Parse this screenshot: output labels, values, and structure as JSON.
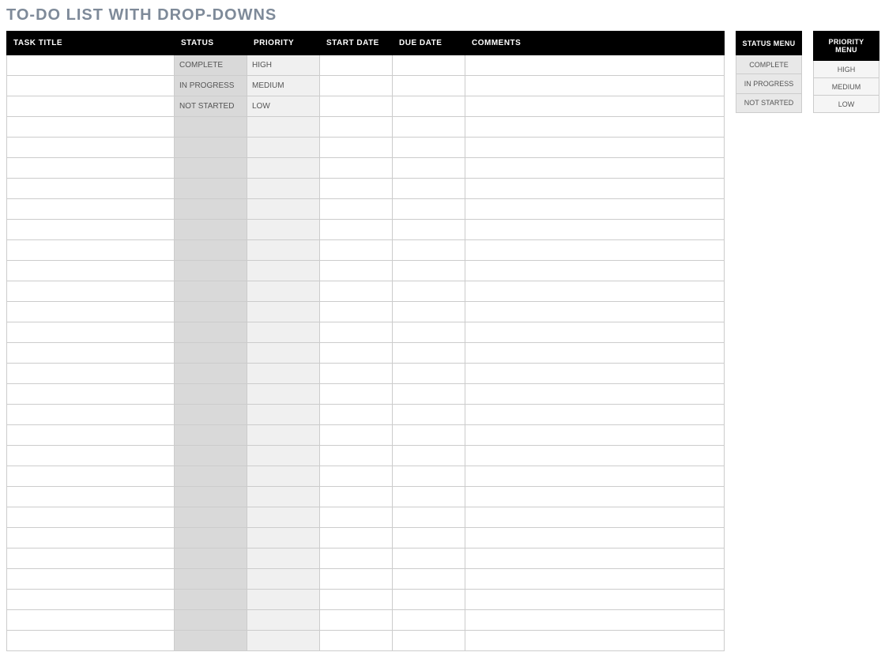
{
  "title": "TO-DO LIST WITH DROP-DOWNS",
  "columns": {
    "task": "TASK TITLE",
    "status": "STATUS",
    "priority": "PRIORITY",
    "start": "START DATE",
    "due": "DUE DATE",
    "comments": "COMMENTS"
  },
  "rows": [
    {
      "task": "",
      "status": "COMPLETE",
      "priority": "HIGH",
      "start": "",
      "due": "",
      "comments": ""
    },
    {
      "task": "",
      "status": "IN PROGRESS",
      "priority": "MEDIUM",
      "start": "",
      "due": "",
      "comments": ""
    },
    {
      "task": "",
      "status": "NOT STARTED",
      "priority": "LOW",
      "start": "",
      "due": "",
      "comments": ""
    },
    {
      "task": "",
      "status": "",
      "priority": "",
      "start": "",
      "due": "",
      "comments": ""
    },
    {
      "task": "",
      "status": "",
      "priority": "",
      "start": "",
      "due": "",
      "comments": ""
    },
    {
      "task": "",
      "status": "",
      "priority": "",
      "start": "",
      "due": "",
      "comments": ""
    },
    {
      "task": "",
      "status": "",
      "priority": "",
      "start": "",
      "due": "",
      "comments": ""
    },
    {
      "task": "",
      "status": "",
      "priority": "",
      "start": "",
      "due": "",
      "comments": ""
    },
    {
      "task": "",
      "status": "",
      "priority": "",
      "start": "",
      "due": "",
      "comments": ""
    },
    {
      "task": "",
      "status": "",
      "priority": "",
      "start": "",
      "due": "",
      "comments": ""
    },
    {
      "task": "",
      "status": "",
      "priority": "",
      "start": "",
      "due": "",
      "comments": ""
    },
    {
      "task": "",
      "status": "",
      "priority": "",
      "start": "",
      "due": "",
      "comments": ""
    },
    {
      "task": "",
      "status": "",
      "priority": "",
      "start": "",
      "due": "",
      "comments": ""
    },
    {
      "task": "",
      "status": "",
      "priority": "",
      "start": "",
      "due": "",
      "comments": ""
    },
    {
      "task": "",
      "status": "",
      "priority": "",
      "start": "",
      "due": "",
      "comments": ""
    },
    {
      "task": "",
      "status": "",
      "priority": "",
      "start": "",
      "due": "",
      "comments": ""
    },
    {
      "task": "",
      "status": "",
      "priority": "",
      "start": "",
      "due": "",
      "comments": ""
    },
    {
      "task": "",
      "status": "",
      "priority": "",
      "start": "",
      "due": "",
      "comments": ""
    },
    {
      "task": "",
      "status": "",
      "priority": "",
      "start": "",
      "due": "",
      "comments": ""
    },
    {
      "task": "",
      "status": "",
      "priority": "",
      "start": "",
      "due": "",
      "comments": ""
    },
    {
      "task": "",
      "status": "",
      "priority": "",
      "start": "",
      "due": "",
      "comments": ""
    },
    {
      "task": "",
      "status": "",
      "priority": "",
      "start": "",
      "due": "",
      "comments": ""
    },
    {
      "task": "",
      "status": "",
      "priority": "",
      "start": "",
      "due": "",
      "comments": ""
    },
    {
      "task": "",
      "status": "",
      "priority": "",
      "start": "",
      "due": "",
      "comments": ""
    },
    {
      "task": "",
      "status": "",
      "priority": "",
      "start": "",
      "due": "",
      "comments": ""
    },
    {
      "task": "",
      "status": "",
      "priority": "",
      "start": "",
      "due": "",
      "comments": ""
    },
    {
      "task": "",
      "status": "",
      "priority": "",
      "start": "",
      "due": "",
      "comments": ""
    },
    {
      "task": "",
      "status": "",
      "priority": "",
      "start": "",
      "due": "",
      "comments": ""
    },
    {
      "task": "",
      "status": "",
      "priority": "",
      "start": "",
      "due": "",
      "comments": ""
    }
  ],
  "status_menu": {
    "header": "STATUS MENU",
    "items": [
      "COMPLETE",
      "IN PROGRESS",
      "NOT STARTED"
    ]
  },
  "priority_menu": {
    "header": "PRIORITY MENU",
    "items": [
      "HIGH",
      "MEDIUM",
      "LOW"
    ]
  }
}
